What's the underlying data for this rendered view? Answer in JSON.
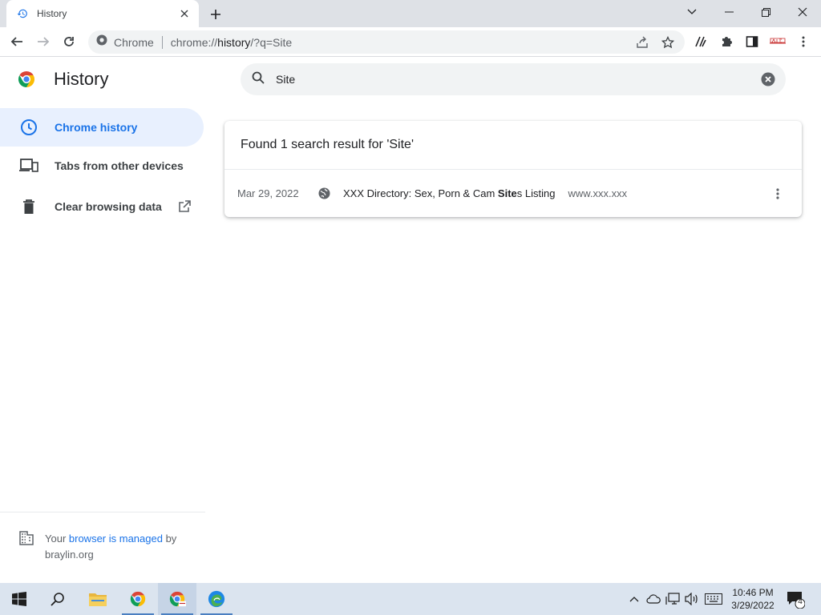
{
  "tab": {
    "title": "History"
  },
  "toolbar": {
    "site_label": "Chrome",
    "url_prefix": "chrome://",
    "url_host": "history",
    "url_suffix": "/?q=Site"
  },
  "page": {
    "title": "History"
  },
  "search": {
    "value": "Site"
  },
  "sidebar": {
    "items": [
      {
        "label": "Chrome history",
        "icon": "clock-icon",
        "active": true
      },
      {
        "label": "Tabs from other devices",
        "icon": "devices-icon",
        "active": false
      },
      {
        "label": "Clear browsing data",
        "icon": "trash-icon",
        "active": false
      }
    ],
    "managed": {
      "prefix": "Your ",
      "link": "browser is managed",
      "suffix": " by",
      "org": "braylin.org"
    }
  },
  "results": {
    "summary": "Found 1 search result for 'Site'",
    "entries": [
      {
        "date": "Mar 29, 2022",
        "title_before": "XXX Directory: Sex, Porn & Cam ",
        "title_match": "Site",
        "title_after": "s Listing",
        "domain": "www.xxx.xxx"
      }
    ]
  },
  "taskbar": {
    "time": "10:46 PM",
    "date": "3/29/2022",
    "notifications": "4"
  },
  "colors": {
    "accent": "#1a73e8",
    "active_bg": "#e8f0fe",
    "tabstrip": "#dee1e6",
    "taskbar": "#dbe4ef"
  }
}
